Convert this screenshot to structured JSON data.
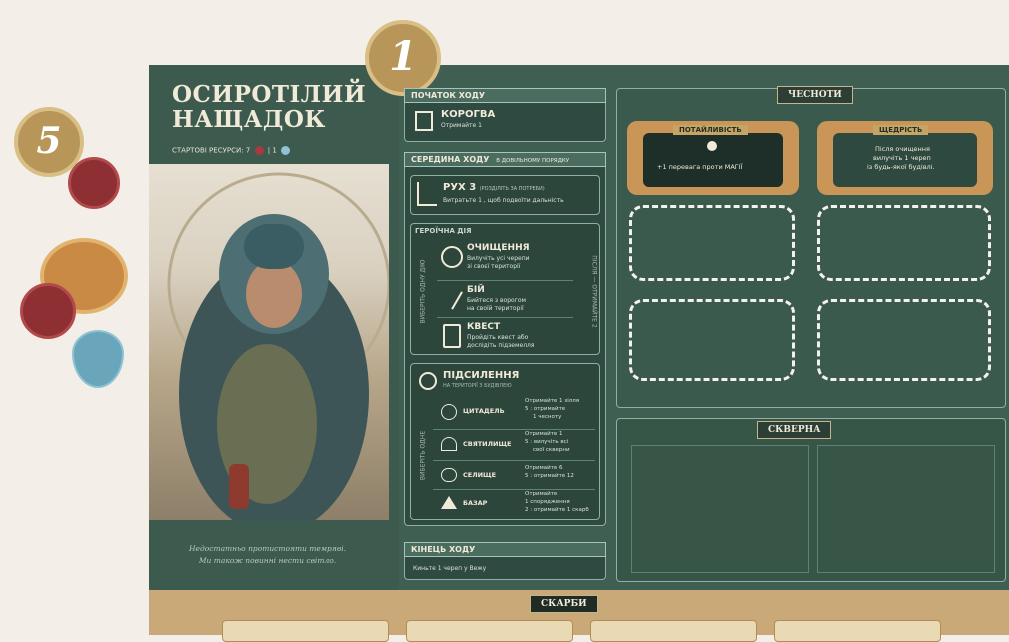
{
  "hero": {
    "name_line1": "ОСИРОТІЛИЙ",
    "name_line2": "НАЩАДОК",
    "start_resources_label": "СТАРТОВІ РЕСУРСИ:",
    "start_red": "7",
    "start_blue": "1",
    "flavor_line1": "Недостатньо протистояти темряві.",
    "flavor_line2": "Ми також повинні нести світло."
  },
  "badges": {
    "one": "1",
    "five": "5"
  },
  "turn_start": {
    "header": "ПОЧАТОК ХОДУ",
    "title": "КОРОГВА",
    "desc": "Отримайте 1"
  },
  "turn_middle": {
    "header": "СЕРЕДИНА ХОДУ",
    "header_note": "В ДОВІЛЬНОМУ ПОРЯДКУ",
    "move_title": "РУХ 3",
    "move_note": "(РОЗДІЛІТЬ ЗА ПОТРЕБИ)",
    "move_desc": "Витратьте 1 , щоб подвоїти дальність",
    "hero_action_header": "ГЕРОЇЧНА ДІЯ",
    "choose_one": "ВИБЕРІТЬ ОДНУ ДІЮ",
    "after": "ПІСЛЯ — ОТРИМАЙТЕ 2",
    "actions": [
      {
        "title": "ОЧИЩЕННЯ",
        "desc1": "Вилучіть усі черепи",
        "desc2": "зі своєї території"
      },
      {
        "title": "БІЙ",
        "desc1": "Бийтеся з ворогом",
        "desc2": "на своїй території"
      },
      {
        "title": "КВЕСТ",
        "desc1": "Пройдіть квест або",
        "desc2": "дослідіть підземелля"
      }
    ],
    "boost_title": "ПІДСИЛЕННЯ",
    "boost_note": "НА ТЕРИТОРІЇ З БУДІВЛЕЮ",
    "choose_one_short": "ВИБЕРІТЬ ОДНЕ",
    "buildings": [
      {
        "name": "ЦИТАДЕЛЬ",
        "effect1": "Отримайте 1 зілля",
        "effect2": "5 : отримайте",
        "effect3": "1 чесноту"
      },
      {
        "name": "СВЯТИЛИЩЕ",
        "effect1": "Отримайте 1",
        "effect2": "5 : вилучіть всі",
        "effect3": "свої скверни"
      },
      {
        "name": "СЕЛИЩЕ",
        "effect1": "Отримайте 6",
        "effect2": "5 : отримайте 12",
        "effect3": ""
      },
      {
        "name": "БАЗАР",
        "effect1": "Отримайте",
        "effect2": "1 спорядження",
        "effect3": "2 : отримайте 1 скарб"
      }
    ]
  },
  "turn_end": {
    "header": "КІНЕЦЬ ХОДУ",
    "desc": "Киньте 1 череп у Вежу"
  },
  "virtues": {
    "header": "ЧЕСНОТИ",
    "card1_title": "ПОТАЙЛИВІСТЬ",
    "card1_text": "+1 перевага проти МАГІЇ",
    "card2_title": "ЩЕДРІСТЬ",
    "card2_text1": "Після очищення",
    "card2_text2": "вилучіть 1 череп",
    "card2_text3": "із будь-якої будівлі."
  },
  "corruption": {
    "header": "СКВЕРНА"
  },
  "treasures": {
    "header": "СКАРБИ"
  },
  "colors": {
    "board": "#3f5f52",
    "accent_gold": "#c6a465",
    "token_red": "#8e2f33",
    "token_blue": "#6aa6bb"
  }
}
